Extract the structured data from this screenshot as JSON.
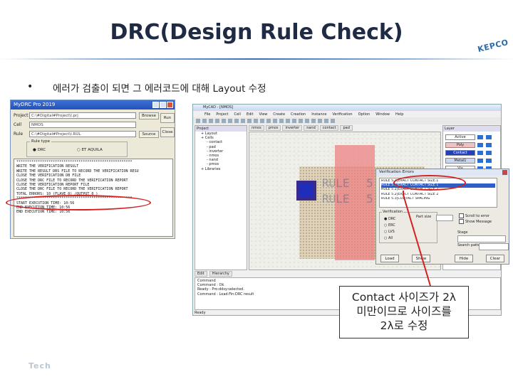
{
  "slide": {
    "title": "DRC(Design Rule Check)",
    "bullet": "에러가 검출이 되면 그 에러코드에 대해 Layout 수정",
    "corner_logo": "KEPCO",
    "bottom_logo": "Tech"
  },
  "mydrc": {
    "title": "MyDRC Pro 2019",
    "project_label": "Project",
    "project_value": "C:\\#Digital#Project\\l.prj",
    "cell_label": "Cell",
    "cell_value": "NMOS",
    "rule_label": "Rule",
    "rule_value": "C:\\#Digital#Project\\l.RUL",
    "browse_label": "Browse",
    "source_label": "Source",
    "run_label": "Run",
    "close_label": "Close",
    "rule_type_legend": "Rule type",
    "rule_type_opt1": "DRC",
    "rule_type_opt2": "ET AQUILA",
    "log": [
      "******************************************************",
      "WRITE THE VERIFICATION RESULT",
      "WRITE THE RESULT DBS FILE TO RECORD THE VERIFICATION RESU",
      "CLOSE THE VERIFICATION DB FILE",
      "CLOSE THE DRC FILE TO RECORD THE VERIFICATION REPORT",
      "CLOSE THE VERIFICATION REPORT FILE",
      "CLOSE THE DRC FILE TO RECORD THE VERIFICATION REPORT",
      "TOTAL ERRORS: 10 (FLAVE 0) /OUTPUT 0 )",
      "******************************************************",
      "START EXECUTION TIME: 10:56",
      "END EXECUTION TIME: 10:56",
      "END EXECUTION TIME: 10:56"
    ]
  },
  "editor": {
    "title": "MyCAD - [NMOS]",
    "menu": [
      "File",
      "Project",
      "Cell",
      "Edit",
      "View",
      "Create",
      "Creation",
      "Instance",
      "Verification",
      "Option",
      "Window",
      "Help"
    ],
    "project_title": "Project",
    "tree": [
      "Layout",
      "Cells",
      "contact",
      "pad",
      "inverter",
      "nmos",
      "nand",
      "pmos",
      "Libraries"
    ],
    "tabs": [
      "nmos",
      "pmos",
      "inverter",
      "nand",
      "contact",
      "pad"
    ],
    "layers_title": "Layer",
    "layers": [
      "Active",
      "Poly",
      "Contact",
      "Metal1",
      "Via",
      "Metal2",
      "Nwell"
    ],
    "bottom_tabs": [
      "Edit",
      "Hierarchy"
    ],
    "console_title": "Command",
    "console": [
      "Command : Ok",
      "Ready : Pro:ddsy:selected.",
      "Command : Load:Fin:DRC result"
    ],
    "status": "Ready",
    "ghost_texts": [
      "RULE",
      "5.1",
      "RULE",
      "5.1"
    ]
  },
  "verification": {
    "title": "Verification Errors",
    "errors": [
      "RULE 5.1|EXACT CONTACT SIZE.1",
      "RULE 5.1|EXACT CONTACT SIZE 1",
      "RULE 5.2|EXACT CONTACT SIZE.2",
      "RULE 5.2|EXACT CONTACT SIZE 2",
      "RULE 5.3|CONTACT SPACING"
    ],
    "verif_legend": "Verification",
    "verif_opts": [
      "DRC",
      "ERC",
      "LVS",
      "All"
    ],
    "part_size_label": "Part size",
    "check1": "Scroll to error",
    "check2": "Show Message",
    "stage_label": "Stage",
    "search_label": "Search pattern",
    "buttons": [
      "Load",
      "Show",
      "Hide",
      "Clear"
    ]
  },
  "annotation": {
    "line1": "Contact 사이즈가 2λ",
    "line2": "미만이므로 사이즈를",
    "line3": "2λ로 수정",
    "accent": "#d42020"
  }
}
